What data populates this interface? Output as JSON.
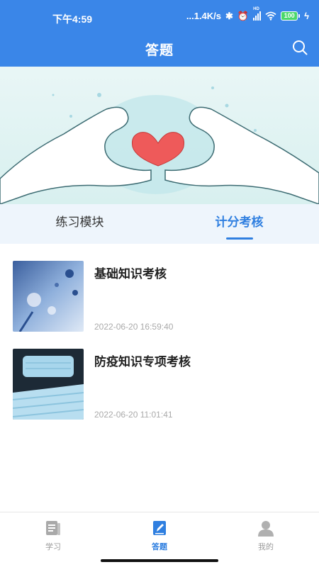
{
  "status_bar": {
    "time": "下午4:59",
    "network_speed": "...1.4K/s",
    "signal_label": "HD",
    "battery": "100"
  },
  "header": {
    "title": "答题"
  },
  "tabs": [
    {
      "label": "练习模块",
      "active": false
    },
    {
      "label": "计分考核",
      "active": true
    }
  ],
  "exams": [
    {
      "title": "基础知识考核",
      "date": "2022-06-20 16:59:40",
      "thumb": "virus-image"
    },
    {
      "title": "防疫知识专项考核",
      "date": "2022-06-20 11:01:41",
      "thumb": "masks-image"
    }
  ],
  "bottom_nav": [
    {
      "label": "学习",
      "icon": "book-icon",
      "active": false
    },
    {
      "label": "答题",
      "icon": "pencil-note-icon",
      "active": true
    },
    {
      "label": "我的",
      "icon": "person-icon",
      "active": false
    }
  ],
  "colors": {
    "primary": "#3a86e8",
    "active_text": "#2f7fe0",
    "tab_bg": "#eef5fc",
    "inactive_nav": "#9a9a9a",
    "date_text": "#aaaaaa"
  }
}
